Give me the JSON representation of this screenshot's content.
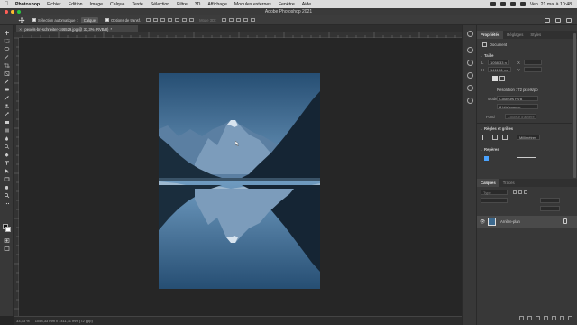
{
  "menubar": {
    "app": "Photoshop",
    "items": [
      "Fichier",
      "Edition",
      "Image",
      "Calque",
      "Texte",
      "Sélection",
      "Filtre",
      "3D",
      "Affichage",
      "Modules externes",
      "Fenêtre",
      "Aide"
    ],
    "datetime": "Ven. 21 mai à 10:48"
  },
  "window": {
    "title": "Adobe Photoshop 2021"
  },
  "options": {
    "auto_select_label": "Sélection automatique :",
    "auto_select_value": "Calque",
    "transform_label": "Options de transf.",
    "mode3d_label": "Mode 3D :"
  },
  "document": {
    "tab_label": "pexels-bri-schneiter-346529.jpg @ 33,3% (RVB/8)",
    "tab_suffix": "*",
    "status_zoom": "33,33 %",
    "status_info": "1058,33 mm x 1411,11 mm (72 ppp)"
  },
  "properties_panel": {
    "tabs": [
      "Propriétés",
      "Réglages",
      "Styles"
    ],
    "doc_label": "Document",
    "section_canvas": "Taille",
    "width_prefix": "L",
    "width_value": "1058,33 n",
    "height_prefix": "H",
    "height_value": "1411,11 mr",
    "x_label": "X",
    "y_label": "Y",
    "resolution": "Résolution : 72 pixels/po",
    "mode_label": "Mode",
    "mode_value": "Couleurs RVB",
    "depth_value": "8 bits/couche",
    "background_label": "Fond",
    "background_value": "Couleur d'arrière",
    "rules_section": "Règles et grilles",
    "units_value": "Millimètres",
    "guides_section": "Repères"
  },
  "layers_panel": {
    "tabs": [
      "Calques",
      "Tracés"
    ],
    "search_placeholder": "Type",
    "layer_name": "Arrière-plan"
  },
  "colors": {
    "menubar_bg": "#dcdcdc",
    "panel_bg": "#383838",
    "canvas_bg": "#262626",
    "sky_top": "#264e73",
    "sky_bottom": "#6f9bc0"
  }
}
